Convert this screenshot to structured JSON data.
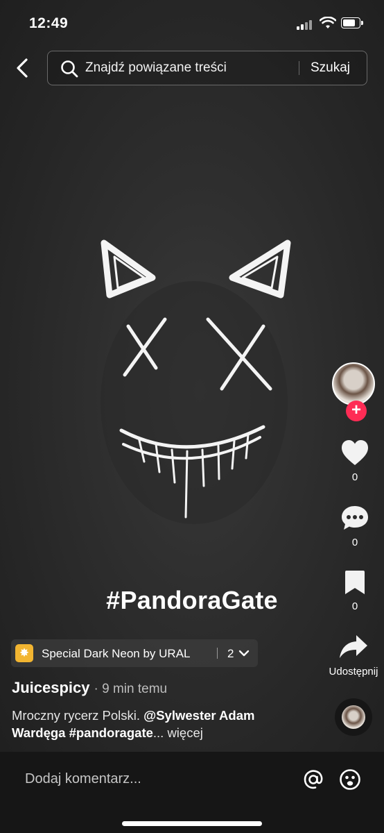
{
  "status_bar": {
    "time": "12:49"
  },
  "search": {
    "text": "Znajdź powiązane treści",
    "button_label": "Szukaj"
  },
  "video": {
    "overlay_text": "#PandoraGate"
  },
  "actions": {
    "likes": "0",
    "comments": "0",
    "saves": "0",
    "share_label": "Udostępnij"
  },
  "effect": {
    "name": "Special Dark Neon by URAL",
    "count": "2"
  },
  "post": {
    "author": "Juicespicy",
    "time_ago": "· 9 min temu",
    "caption_text": "Mroczny rycerz Polski. ",
    "caption_mention": "@Sylwester Adam Wardęga #pandoragate",
    "caption_more": "... więcej"
  },
  "comment": {
    "placeholder": "Dodaj komentarz..."
  },
  "colors": {
    "accent": "#fe2c55",
    "effect_badge": "#f2b531",
    "background": "#2b2b2b"
  }
}
